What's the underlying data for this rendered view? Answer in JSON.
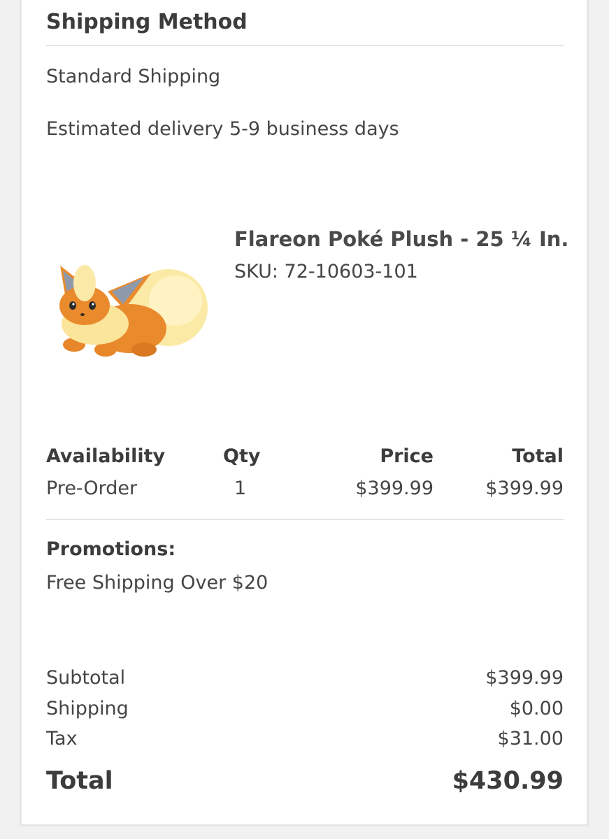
{
  "shipping": {
    "heading": "Shipping Method",
    "method": "Standard Shipping",
    "estimate": "Estimated delivery 5-9 business days"
  },
  "product": {
    "name": "Flareon Poké Plush - 25 ¼ In.",
    "sku": "SKU: 72-10603-101",
    "image_subject": "flareon-plush"
  },
  "line_table": {
    "headers": {
      "availability": "Availability",
      "qty": "Qty",
      "price": "Price",
      "total": "Total"
    },
    "row": {
      "availability": "Pre-Order",
      "qty": "1",
      "price": "$399.99",
      "total": "$399.99"
    }
  },
  "promotions": {
    "heading": "Promotions:",
    "item": "Free Shipping Over $20"
  },
  "summary": {
    "subtotal_label": "Subtotal",
    "subtotal_value": "$399.99",
    "shipping_label": "Shipping",
    "shipping_value": "$0.00",
    "tax_label": "Tax",
    "tax_value": "$31.00",
    "total_label": "Total",
    "total_value": "$430.99"
  },
  "colors": {
    "page_bg": "#f1f1f1",
    "card_bg": "#ffffff",
    "text": "#454545",
    "divider": "#e4e4e4",
    "plush_orange": "#e98a2c",
    "plush_cream": "#fbe8a0"
  }
}
